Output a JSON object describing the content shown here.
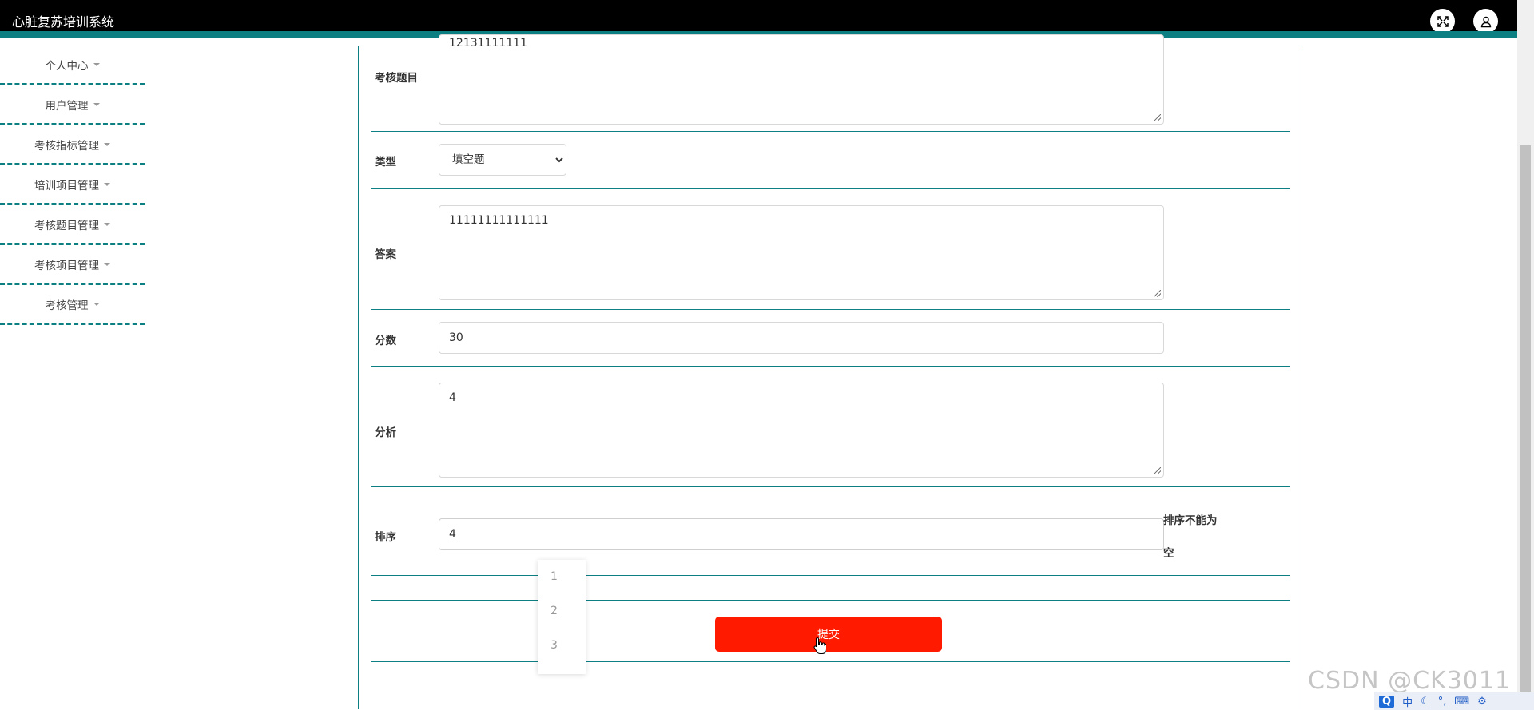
{
  "app": {
    "title": "心脏复苏培训系统"
  },
  "header": {
    "icons": [
      "fullscreen-icon",
      "user-icon"
    ]
  },
  "sidebar": {
    "items": [
      {
        "label": "个人中心"
      },
      {
        "label": "用户管理"
      },
      {
        "label": "考核指标管理"
      },
      {
        "label": "培训项目管理"
      },
      {
        "label": "考核题目管理"
      },
      {
        "label": "考核项目管理"
      },
      {
        "label": "考核管理"
      }
    ]
  },
  "form": {
    "question": {
      "label": "考核题目",
      "value": "12131111111"
    },
    "type": {
      "label": "类型",
      "value": "填空题"
    },
    "answer": {
      "label": "答案",
      "value": "11111111111111"
    },
    "score": {
      "label": "分数",
      "value": "30"
    },
    "analysis": {
      "label": "分析",
      "value": "4"
    },
    "order": {
      "label": "排序",
      "value": "4",
      "error": "排序不能为空",
      "error_line1": "排序不能为",
      "error_line2": "空",
      "suggestions": [
        "1",
        "2",
        "3"
      ]
    },
    "submit_label": "提交"
  },
  "watermark": "CSDN @CK3011",
  "ime": {
    "label": "中"
  },
  "colors": {
    "accent": "#0b7f82",
    "submit": "#ff1a00",
    "topbar": "#000000"
  }
}
